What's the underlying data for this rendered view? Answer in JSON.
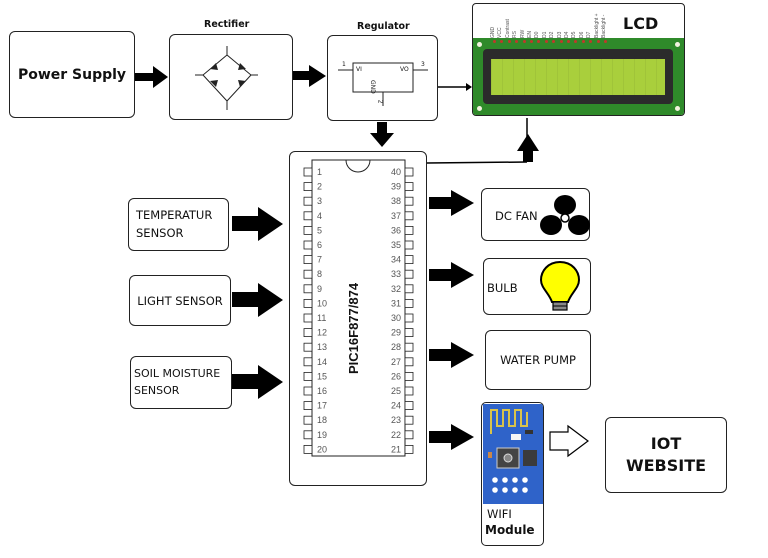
{
  "diagram": {
    "power_supply": {
      "label": "Power Supply"
    },
    "rectifier": {
      "title": "Rectifier"
    },
    "regulator": {
      "title": "Regulator",
      "pin_in_num": "1",
      "pin_in_label": "VI",
      "pin_out_num": "3",
      "pin_out_label": "VO",
      "pin_gnd_num": "2",
      "pin_gnd_label": "GND"
    },
    "lcd": {
      "title": "LCD",
      "pins": [
        "GND",
        "VCC",
        "Contrast",
        "RS",
        "RW",
        "EN",
        "D0",
        "D1",
        "D2",
        "D3",
        "D4",
        "D5",
        "D6",
        "D7",
        "Backlight +",
        "Backlight -"
      ],
      "colors": {
        "pcb": "#2f8a2a",
        "screen": "#a9cf3c",
        "bezel": "#2b2b2b"
      }
    },
    "microcontroller": {
      "label": "PIC16F877/874",
      "left_pins": [
        "1",
        "2",
        "3",
        "4",
        "5",
        "6",
        "7",
        "8",
        "9",
        "10",
        "11",
        "12",
        "13",
        "14",
        "15",
        "16",
        "17",
        "18",
        "19",
        "20"
      ],
      "right_pins": [
        "40",
        "39",
        "38",
        "37",
        "36",
        "35",
        "34",
        "33",
        "32",
        "31",
        "30",
        "29",
        "28",
        "27",
        "26",
        "25",
        "24",
        "23",
        "22",
        "21"
      ]
    },
    "inputs": [
      {
        "line1": "TEMPERATUR",
        "line2": "SENSOR"
      },
      {
        "line1": "LIGHT SENSOR",
        "line2": ""
      },
      {
        "line1": "SOIL MOISTURE",
        "line2": "SENSOR"
      }
    ],
    "outputs": {
      "fan": {
        "label": "DC FAN"
      },
      "bulb": {
        "label": "BULB",
        "color": "#ffff00"
      },
      "pump": {
        "label": "WATER PUMP"
      }
    },
    "wifi": {
      "line1": "WIFI",
      "line2": "Module",
      "color": "#2f63c9"
    },
    "iot": {
      "line1": "IOT",
      "line2": "WEBSITE"
    }
  }
}
